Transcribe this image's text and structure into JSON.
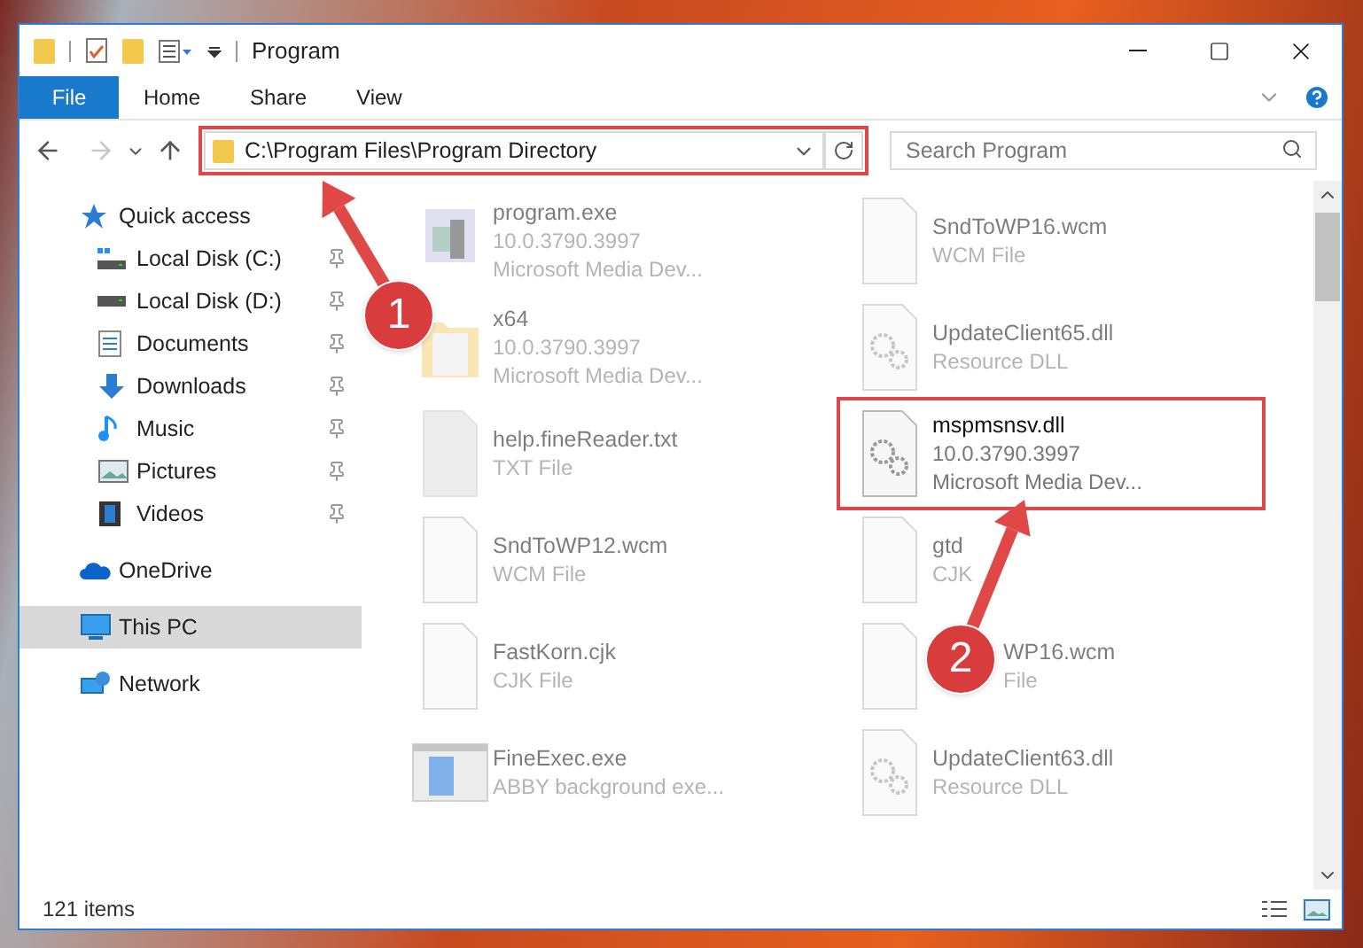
{
  "window": {
    "title": "Program"
  },
  "ribbon_tabs": [
    {
      "label": "File",
      "selected": true
    },
    {
      "label": "Home",
      "selected": false
    },
    {
      "label": "Share",
      "selected": false
    },
    {
      "label": "View",
      "selected": false
    }
  ],
  "address_bar": {
    "value": "C:\\Program Files\\Program Directory"
  },
  "search": {
    "placeholder": "Search Program"
  },
  "nav": {
    "forward_disabled": true
  },
  "sidebar": {
    "items": [
      {
        "label": "Quick access",
        "kind": "quick",
        "selected": false,
        "pinned": false,
        "children": [
          {
            "label": "Local Disk (C:)",
            "kind": "disk-c",
            "selected": false,
            "pinned": true
          },
          {
            "label": "Local Disk (D:)",
            "kind": "disk",
            "selected": false,
            "pinned": true
          },
          {
            "label": "Documents",
            "kind": "documents",
            "selected": false,
            "pinned": true
          },
          {
            "label": "Downloads",
            "kind": "downloads",
            "selected": false,
            "pinned": true
          },
          {
            "label": "Music",
            "kind": "music",
            "selected": false,
            "pinned": true
          },
          {
            "label": "Pictures",
            "kind": "pictures",
            "selected": false,
            "pinned": true
          },
          {
            "label": "Videos",
            "kind": "videos",
            "selected": false,
            "pinned": true
          }
        ]
      },
      {
        "label": "OneDrive",
        "kind": "cloud",
        "selected": false,
        "pinned": false
      },
      {
        "label": "This PC",
        "kind": "pc",
        "selected": true,
        "pinned": false
      },
      {
        "label": "Network",
        "kind": "network",
        "selected": false,
        "pinned": false
      }
    ]
  },
  "file_columns": [
    [
      {
        "name": "program.exe",
        "lines": [
          "10.0.3790.3997",
          "Microsoft Media Dev..."
        ],
        "kind": "exe",
        "faded": true,
        "highlighted": false,
        "covered_start": false
      },
      {
        "name": "x64",
        "lines": [
          "10.0.3790.3997",
          "Microsoft Media Dev..."
        ],
        "kind": "folder",
        "faded": true,
        "highlighted": false,
        "covered_start": false
      },
      {
        "name": "help.fineReader.txt",
        "lines": [
          "TXT File"
        ],
        "kind": "text",
        "faded": true,
        "highlighted": false,
        "covered_start": false
      },
      {
        "name": "SndToWP12.wcm",
        "lines": [
          "WCM File"
        ],
        "kind": "blank",
        "faded": true,
        "highlighted": false,
        "covered_start": false
      },
      {
        "name": "FastKorn.cjk",
        "lines": [
          "CJK File"
        ],
        "kind": "blank",
        "faded": true,
        "highlighted": false,
        "covered_start": false
      },
      {
        "name": "FineExec.exe",
        "lines": [
          "ABBY background exe..."
        ],
        "kind": "app",
        "faded": true,
        "highlighted": false,
        "covered_start": false
      }
    ],
    [
      {
        "name": "SndToWP16.wcm",
        "lines": [
          "WCM File"
        ],
        "kind": "blank",
        "faded": true,
        "highlighted": false,
        "covered_start": false
      },
      {
        "name": "UpdateClient65.dll",
        "lines": [
          "Resource DLL"
        ],
        "kind": "dll",
        "faded": true,
        "highlighted": false,
        "covered_start": false
      },
      {
        "name": "mspmsnsv.dll",
        "lines": [
          "10.0.3790.3997",
          "Microsoft Media Dev..."
        ],
        "kind": "dll",
        "faded": false,
        "highlighted": true,
        "covered_start": false
      },
      {
        "name": "gtd",
        "lines": [
          "CJK"
        ],
        "kind": "blank",
        "faded": true,
        "highlighted": false,
        "covered_start": false
      },
      {
        "name": "WP16.wcm",
        "lines": [
          "File"
        ],
        "kind": "blank",
        "faded": true,
        "highlighted": false,
        "covered_start": true
      },
      {
        "name": "UpdateClient63.dll",
        "lines": [
          "Resource DLL"
        ],
        "kind": "dll",
        "faded": true,
        "highlighted": false,
        "covered_start": false
      }
    ]
  ],
  "status_bar": {
    "count": "121 items"
  },
  "annotations": [
    {
      "number": "1",
      "kind": "address"
    },
    {
      "number": "2",
      "kind": "file"
    }
  ]
}
